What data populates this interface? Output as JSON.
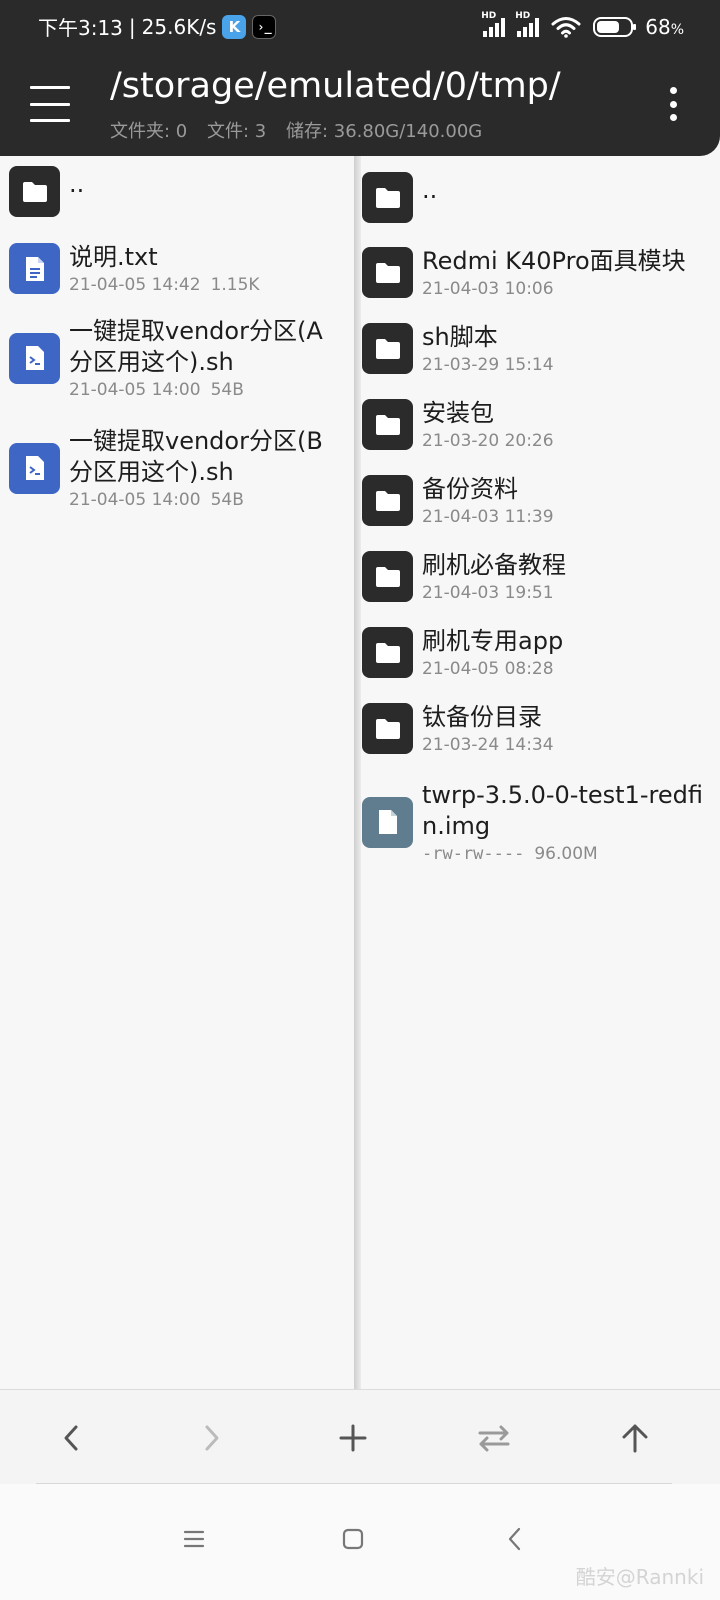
{
  "status": {
    "time": "下午3:13",
    "separator": "|",
    "speed": "25.6K/s",
    "app_badges": [
      "K",
      "›_"
    ],
    "network_label": "HD",
    "battery": "68",
    "battery_unit": "%",
    "battery_level": 0.68
  },
  "toolbar": {
    "path": "/storage/emulated/0/tmp/",
    "stats": [
      "文件夹: 0",
      "文件: 3",
      "储存: 36.80G/140.00G"
    ]
  },
  "left_pane": {
    "parent": "..",
    "items": [
      {
        "name": "说明.txt",
        "date": "21-04-05 14:42",
        "size": "1.15K",
        "icon": "text-file-icon"
      },
      {
        "name": "一键提取vendor分区(A分区用这个).sh",
        "date": "21-04-05 14:00",
        "size": "54B",
        "icon": "script-file-icon"
      },
      {
        "name": "一键提取vendor分区(B分区用这个).sh",
        "date": "21-04-05 14:00",
        "size": "54B",
        "icon": "script-file-icon"
      }
    ]
  },
  "right_pane": {
    "parent": "..",
    "items": [
      {
        "name": "Redmi K40Pro面具模块",
        "date": "21-04-03 10:06",
        "icon": "folder-icon"
      },
      {
        "name": "sh脚本",
        "date": "21-03-29 15:14",
        "icon": "folder-icon"
      },
      {
        "name": "安装包",
        "date": "21-03-20 20:26",
        "icon": "folder-icon"
      },
      {
        "name": "备份资料",
        "date": "21-04-03 11:39",
        "icon": "folder-icon"
      },
      {
        "name": "刷机必备教程",
        "date": "21-04-03 19:51",
        "icon": "folder-icon"
      },
      {
        "name": "刷机专用app",
        "date": "21-04-05 08:28",
        "icon": "folder-icon"
      },
      {
        "name": "钛备份目录",
        "date": "21-03-24 14:34",
        "icon": "folder-icon"
      },
      {
        "name": "twrp-3.5.0-0-test1-redfin.img",
        "permissions": "-rw-rw----",
        "size": "96.00M",
        "icon": "image-file-icon"
      }
    ]
  },
  "actions": [
    "back-icon",
    "forward-icon",
    "add-icon",
    "swap-panes-icon",
    "up-directory-icon"
  ],
  "navbar": [
    "recents-icon",
    "home-icon",
    "back-nav-icon"
  ],
  "watermark": "酷安@Rannki",
  "colors": {
    "bar_dark": "#2a2a2a",
    "folder_icon": "#2b2b2b",
    "file_icon_blue": "#3e66c4",
    "image_icon_gray": "#5f7d8e",
    "meta_text": "#8a8a8a"
  }
}
